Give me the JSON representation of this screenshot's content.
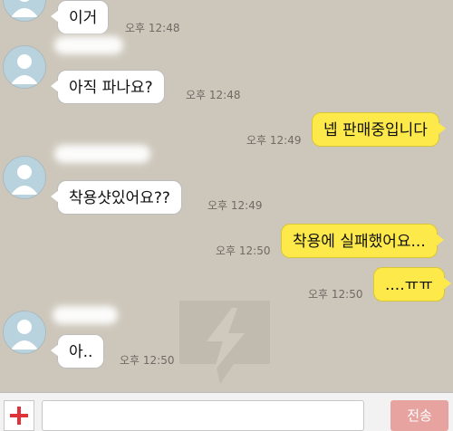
{
  "messages": [
    {
      "side": "in",
      "text": "이거",
      "time": "오후 12:48"
    },
    {
      "side": "in",
      "text": "아직 파나요?",
      "time": "오후 12:48"
    },
    {
      "side": "out",
      "text": "넵 판매중입니다",
      "time": "오후 12:49"
    },
    {
      "side": "in",
      "text": "착용샷있어요??",
      "time": "오후 12:49"
    },
    {
      "side": "out",
      "text": "착용에 실패했어요...",
      "time": "오후 12:50"
    },
    {
      "side": "out",
      "text": "....ㅠㅠ",
      "time": "오후 12:50"
    },
    {
      "side": "in",
      "text": "아..",
      "time": "오후 12:50"
    }
  ],
  "composer": {
    "send_label": "전송",
    "input_value": ""
  },
  "icons": {
    "avatar": "default-profile-icon",
    "attach": "plus-icon",
    "watermark": "lightning-chat-icon"
  },
  "colors": {
    "background": "#cdc7bb",
    "incoming_bubble": "#ffffff",
    "outgoing_bubble": "#fde94a",
    "plus": "#e0323a",
    "send_button": "#e6a3a0"
  }
}
